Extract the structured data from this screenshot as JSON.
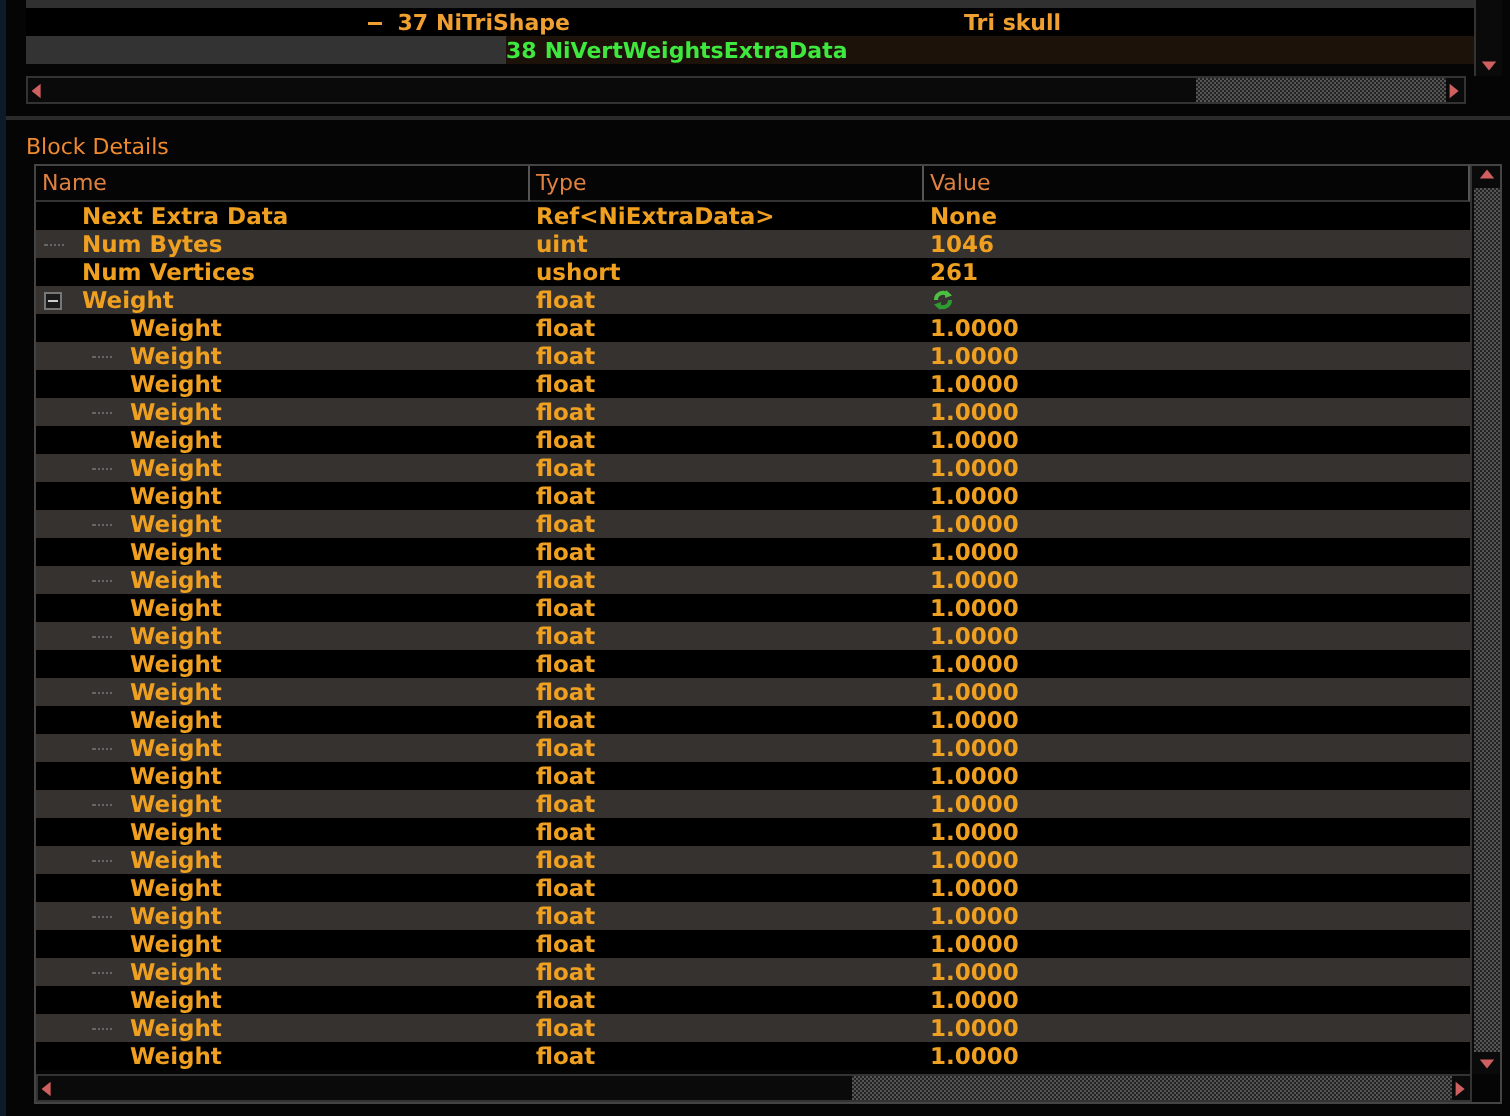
{
  "tree": {
    "rows": [
      {
        "number": "37",
        "name": "NiTriShape",
        "value": "Tri skull",
        "expanded": true,
        "selected": false
      },
      {
        "number": "38",
        "name": "NiVertWeightsExtraData",
        "selected": true
      }
    ]
  },
  "block_details": {
    "title": "Block Details",
    "columns": [
      "Name",
      "Type",
      "Value"
    ],
    "rows": [
      {
        "name": "Next Extra Data",
        "type": "Ref<NiExtraData>",
        "value": "None"
      },
      {
        "name": "Num Bytes",
        "type": "uint",
        "value": "1046"
      },
      {
        "name": "Num Vertices",
        "type": "ushort",
        "value": "261"
      },
      {
        "name": "Weight",
        "type": "float",
        "expanded": true,
        "children": [
          {
            "name": "Weight",
            "type": "float",
            "value": "1.0000"
          },
          {
            "name": "Weight",
            "type": "float",
            "value": "1.0000"
          },
          {
            "name": "Weight",
            "type": "float",
            "value": "1.0000"
          },
          {
            "name": "Weight",
            "type": "float",
            "value": "1.0000"
          },
          {
            "name": "Weight",
            "type": "float",
            "value": "1.0000"
          },
          {
            "name": "Weight",
            "type": "float",
            "value": "1.0000"
          },
          {
            "name": "Weight",
            "type": "float",
            "value": "1.0000"
          },
          {
            "name": "Weight",
            "type": "float",
            "value": "1.0000"
          },
          {
            "name": "Weight",
            "type": "float",
            "value": "1.0000"
          },
          {
            "name": "Weight",
            "type": "float",
            "value": "1.0000"
          },
          {
            "name": "Weight",
            "type": "float",
            "value": "1.0000"
          },
          {
            "name": "Weight",
            "type": "float",
            "value": "1.0000"
          },
          {
            "name": "Weight",
            "type": "float",
            "value": "1.0000"
          },
          {
            "name": "Weight",
            "type": "float",
            "value": "1.0000"
          },
          {
            "name": "Weight",
            "type": "float",
            "value": "1.0000"
          },
          {
            "name": "Weight",
            "type": "float",
            "value": "1.0000"
          },
          {
            "name": "Weight",
            "type": "float",
            "value": "1.0000"
          },
          {
            "name": "Weight",
            "type": "float",
            "value": "1.0000"
          },
          {
            "name": "Weight",
            "type": "float",
            "value": "1.0000"
          },
          {
            "name": "Weight",
            "type": "float",
            "value": "1.0000"
          },
          {
            "name": "Weight",
            "type": "float",
            "value": "1.0000"
          },
          {
            "name": "Weight",
            "type": "float",
            "value": "1.0000"
          },
          {
            "name": "Weight",
            "type": "float",
            "value": "1.0000"
          },
          {
            "name": "Weight",
            "type": "float",
            "value": "1.0000"
          },
          {
            "name": "Weight",
            "type": "float",
            "value": "1.0000"
          },
          {
            "name": "Weight",
            "type": "float",
            "value": "1.0000"
          },
          {
            "name": "Weight",
            "type": "float",
            "value": "1.0000"
          }
        ]
      }
    ]
  }
}
